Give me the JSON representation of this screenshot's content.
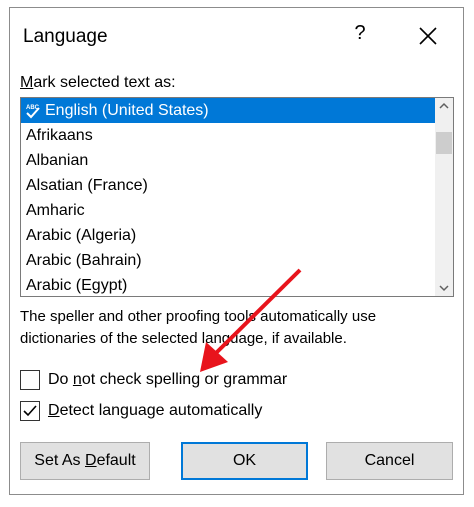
{
  "dialog": {
    "title": "Language",
    "help_label": "?",
    "mark_label_accel": "M",
    "mark_label_rest": "ark selected text as:",
    "languages": [
      "English (United States)",
      "Afrikaans",
      "Albanian",
      "Alsatian (France)",
      "Amharic",
      "Arabic (Algeria)",
      "Arabic (Bahrain)",
      "Arabic (Egypt)"
    ],
    "selected_language": "English (United States)",
    "info_text": "The speller and other proofing tools automatically use dictionaries of the selected language, if available.",
    "checkbox_no_check": {
      "pre": "Do ",
      "accel": "n",
      "post": "ot check spelling or grammar",
      "checked": false
    },
    "checkbox_detect": {
      "accel": "D",
      "post": "etect language automatically",
      "checked": true
    },
    "buttons": {
      "set_default_pre": "Set As ",
      "set_default_accel": "D",
      "set_default_post": "efault",
      "ok": "OK",
      "cancel": "Cancel"
    }
  },
  "colors": {
    "selection": "#0078d7",
    "annotation_arrow": "#e8141c"
  }
}
